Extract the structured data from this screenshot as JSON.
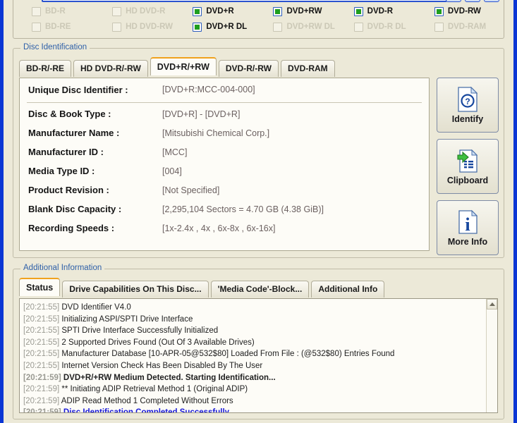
{
  "window": {
    "buttons": [
      {
        "name": "minimize",
        "label": ""
      },
      {
        "name": "maximize",
        "label": ""
      },
      {
        "name": "close",
        "label": ""
      }
    ]
  },
  "capabilities": {
    "items": [
      {
        "label": "BD-R",
        "checked": false
      },
      {
        "label": "HD DVD-R",
        "checked": false
      },
      {
        "label": "DVD+R",
        "checked": true
      },
      {
        "label": "DVD+RW",
        "checked": true
      },
      {
        "label": "DVD-R",
        "checked": true
      },
      {
        "label": "DVD-RW",
        "checked": true
      },
      {
        "label": "BD-RE",
        "checked": false
      },
      {
        "label": "HD DVD-RW",
        "checked": false
      },
      {
        "label": "DVD+R DL",
        "checked": true
      },
      {
        "label": "DVD+RW DL",
        "checked": false
      },
      {
        "label": "DVD-R DL",
        "checked": false
      },
      {
        "label": "DVD-RAM",
        "checked": false
      }
    ]
  },
  "disc_identification": {
    "group_title": "Disc Identification",
    "tabs": [
      {
        "label": "BD-R/-RE",
        "active": false
      },
      {
        "label": "HD DVD-R/-RW",
        "active": false
      },
      {
        "label": "DVD+R/+RW",
        "active": true
      },
      {
        "label": "DVD-R/-RW",
        "active": false
      },
      {
        "label": "DVD-RAM",
        "active": false
      }
    ],
    "fields": [
      {
        "label": "Unique Disc Identifier :",
        "value": "[DVD+R:MCC-004-000]"
      },
      {
        "label": "Disc & Book Type :",
        "value": "[DVD+R] - [DVD+R]"
      },
      {
        "label": "Manufacturer Name :",
        "value": "[Mitsubishi Chemical Corp.]"
      },
      {
        "label": "Manufacturer ID :",
        "value": "[MCC]"
      },
      {
        "label": "Media Type ID :",
        "value": "[004]"
      },
      {
        "label": "Product Revision :",
        "value": "[Not Specified]"
      },
      {
        "label": "Blank Disc Capacity :",
        "value": "[2,295,104 Sectors = 4.70 GB (4.38 GiB)]"
      },
      {
        "label": "Recording Speeds :",
        "value": "[1x-2.4x , 4x , 6x-8x , 6x-16x]"
      }
    ],
    "side_buttons": [
      {
        "label": "Identify",
        "icon": "document-question-icon"
      },
      {
        "label": "Clipboard",
        "icon": "document-clipboard-icon"
      },
      {
        "label": "More Info",
        "icon": "document-info-icon"
      }
    ]
  },
  "additional_information": {
    "group_title": "Additional Information",
    "tabs": [
      {
        "label": "Status",
        "active": true
      },
      {
        "label": "Drive Capabilities On This Disc...",
        "active": false
      },
      {
        "label": "'Media Code'-Block...",
        "active": false
      },
      {
        "label": "Additional Info",
        "active": false
      }
    ],
    "log": [
      {
        "time": "[20:21:55]",
        "text": "DVD Identifier V4.0",
        "style": "normal"
      },
      {
        "time": "[20:21:55]",
        "text": "Initializing ASPI/SPTI Drive Interface",
        "style": "normal"
      },
      {
        "time": "[20:21:55]",
        "text": "SPTI Drive Interface Successfully Initialized",
        "style": "normal"
      },
      {
        "time": "[20:21:55]",
        "text": "2 Supported Drives Found (Out Of 3 Available Drives)",
        "style": "normal"
      },
      {
        "time": "[20:21:55]",
        "text": "Manufacturer Database [10-APR-05@532$80] Loaded From File : (@532$80) Entries Found",
        "style": "normal"
      },
      {
        "time": "[20:21:55]",
        "text": "Internet Version Check Has Been Disabled By The User",
        "style": "normal"
      },
      {
        "time": "[20:21:59]",
        "text": "DVD+R/+RW Medium Detected. Starting Identification...",
        "style": "bold"
      },
      {
        "time": "[20:21:59]",
        "text": "** Initiating ADIP Retrieval Method 1 (Original ADIP)",
        "style": "normal"
      },
      {
        "time": "[20:21:59]",
        "text": "ADIP Read Method 1 Completed Without Errors",
        "style": "normal"
      },
      {
        "time": "[20:21:59]",
        "text": "Disc Identification Completed Successfully",
        "style": "link"
      }
    ]
  },
  "colors": {
    "accent_orange": "#f0a21e",
    "window_border_blue": "#0a36d4",
    "group_title_blue": "#2d5fa8",
    "checkbox_green": "#1e9e1e",
    "link_blue": "#1717d8",
    "background": "#ece9d8"
  }
}
